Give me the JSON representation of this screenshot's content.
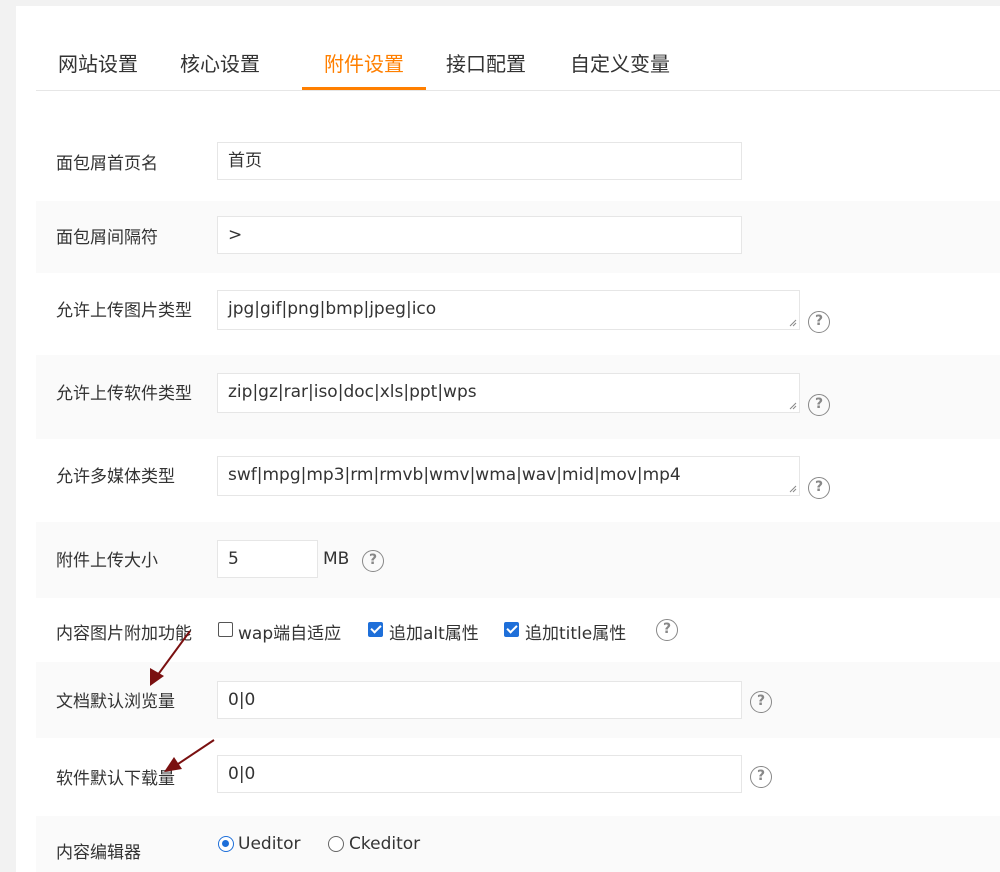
{
  "tabs": [
    {
      "label": "网站设置"
    },
    {
      "label": "核心设置"
    },
    {
      "label": "附件设置"
    },
    {
      "label": "接口配置"
    },
    {
      "label": "自定义变量"
    }
  ],
  "active_tab": "附件设置",
  "fields": {
    "breadcrumb_home": {
      "label": "面包屑首页名",
      "value": "首页"
    },
    "breadcrumb_sep": {
      "label": "面包屑间隔符",
      "value": ">"
    },
    "img_types": {
      "label": "允许上传图片类型",
      "value": "jpg|gif|png|bmp|jpeg|ico"
    },
    "soft_types": {
      "label": "允许上传软件类型",
      "value": "zip|gz|rar|iso|doc|xls|ppt|wps"
    },
    "media_types": {
      "label": "允许多媒体类型",
      "value": "swf|mpg|mp3|rm|rmvb|wmv|wma|wav|mid|mov|mp4"
    },
    "upload_size": {
      "label": "附件上传大小",
      "value": "5",
      "unit": "MB"
    },
    "img_extra": {
      "label": "内容图片附加功能",
      "options": [
        {
          "label": "wap端自适应",
          "checked": false
        },
        {
          "label": "追加alt属性",
          "checked": true
        },
        {
          "label": "追加title属性",
          "checked": true
        }
      ]
    },
    "doc_views": {
      "label": "文档默认浏览量",
      "value": "0|0"
    },
    "soft_downloads": {
      "label": "软件默认下载量",
      "value": "0|0"
    },
    "editor": {
      "label": "内容编辑器",
      "options": [
        {
          "label": "Ueditor",
          "selected": true
        },
        {
          "label": "Ckeditor",
          "selected": false
        }
      ]
    }
  },
  "help_glyph": "?",
  "colors": {
    "accent": "#ff7f00",
    "check": "#1e6fd9",
    "arrow": "#7a1010"
  }
}
